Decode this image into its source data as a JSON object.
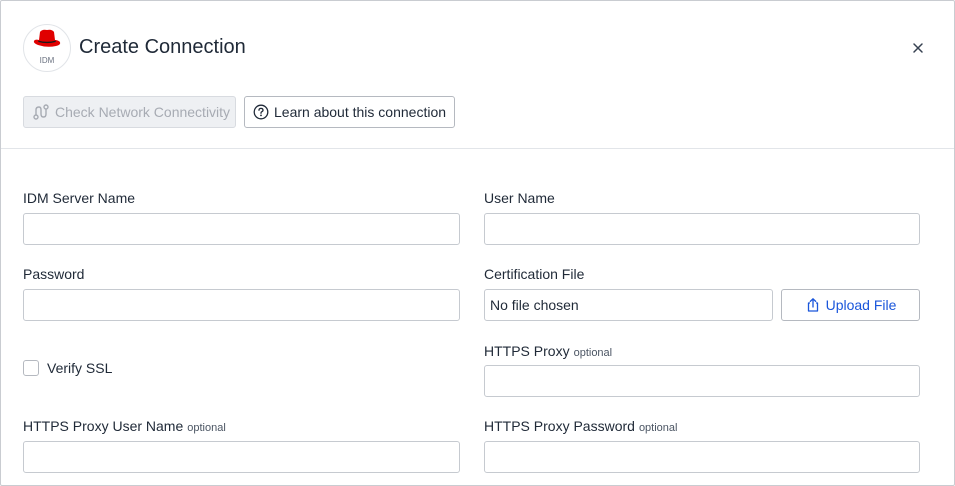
{
  "dialog": {
    "title": "Create Connection",
    "logo_text": "IDM",
    "brand_color": "#e00000"
  },
  "toolbar": {
    "check_network_label": "Check Network Connectivity",
    "learn_label": "Learn about this connection"
  },
  "form": {
    "idm_server_name": {
      "label": "IDM Server Name",
      "value": ""
    },
    "user_name": {
      "label": "User Name",
      "value": ""
    },
    "password": {
      "label": "Password",
      "value": ""
    },
    "certification_file": {
      "label": "Certification File",
      "status": "No file chosen",
      "upload_label": "Upload File"
    },
    "verify_ssl": {
      "label": "Verify SSL",
      "checked": false
    },
    "https_proxy": {
      "label": "HTTPS Proxy",
      "optional": "optional",
      "value": ""
    },
    "https_proxy_user_name": {
      "label": "HTTPS Proxy User Name",
      "optional": "optional",
      "value": ""
    },
    "https_proxy_password": {
      "label": "HTTPS Proxy Password",
      "optional": "optional",
      "value": ""
    }
  },
  "icons": {
    "close": "close-icon",
    "network": "route-icon",
    "help": "help-circle-icon",
    "upload": "upload-icon",
    "logo": "red-hat-fedora-icon"
  },
  "colors": {
    "link_blue": "#1a56db",
    "disabled_text": "#a7abb3"
  }
}
